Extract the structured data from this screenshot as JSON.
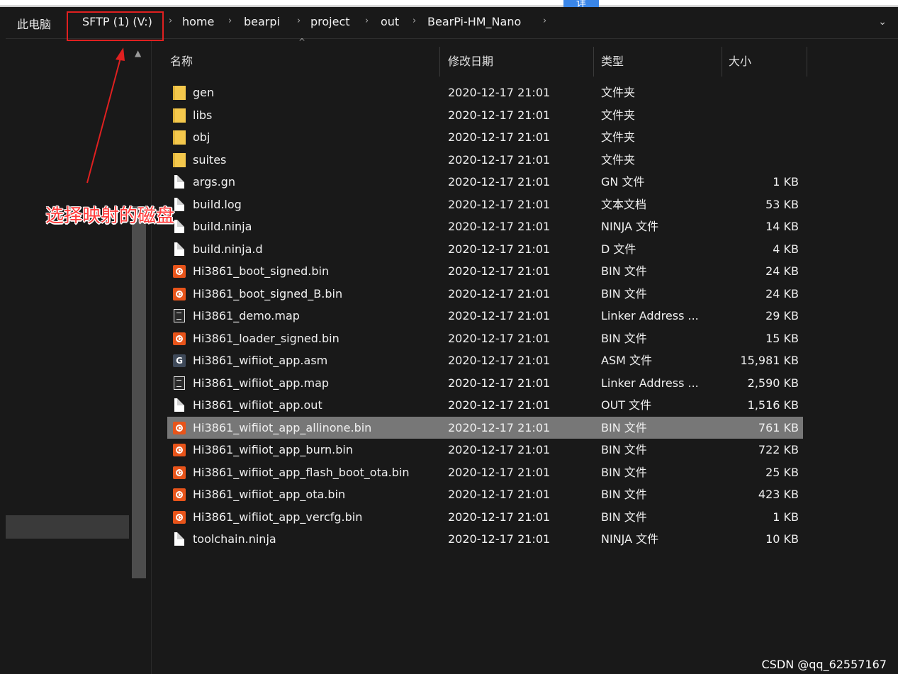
{
  "top_button": {
    "label": "详"
  },
  "address_bar": {
    "crumbs": [
      "此电脑",
      "SFTP (1) (V:)",
      "home",
      "bearpi",
      "project",
      "out",
      "BearPi-HM_Nano"
    ],
    "separator": "›",
    "dropdown": "⌄"
  },
  "annotation": {
    "text": "选择映射的磁盘",
    "color": "#e02020"
  },
  "columns": {
    "name": "名称",
    "date": "修改日期",
    "type": "类型",
    "size": "大小"
  },
  "files": [
    {
      "name": "gen",
      "date": "2020-12-17 21:01",
      "type": "文件夹",
      "size": "",
      "icon": "folder-icon"
    },
    {
      "name": "libs",
      "date": "2020-12-17 21:01",
      "type": "文件夹",
      "size": "",
      "icon": "folder-icon"
    },
    {
      "name": "obj",
      "date": "2020-12-17 21:01",
      "type": "文件夹",
      "size": "",
      "icon": "folder-icon"
    },
    {
      "name": "suites",
      "date": "2020-12-17 21:01",
      "type": "文件夹",
      "size": "",
      "icon": "folder-icon"
    },
    {
      "name": "args.gn",
      "date": "2020-12-17 21:01",
      "type": "GN 文件",
      "size": "1 KB",
      "icon": "file-icon"
    },
    {
      "name": "build.log",
      "date": "2020-12-17 21:01",
      "type": "文本文档",
      "size": "53 KB",
      "icon": "file-icon"
    },
    {
      "name": "build.ninja",
      "date": "2020-12-17 21:01",
      "type": "NINJA 文件",
      "size": "14 KB",
      "icon": "file-icon"
    },
    {
      "name": "build.ninja.d",
      "date": "2020-12-17 21:01",
      "type": "D 文件",
      "size": "4 KB",
      "icon": "file-icon"
    },
    {
      "name": "Hi3861_boot_signed.bin",
      "date": "2020-12-17 21:01",
      "type": "BIN 文件",
      "size": "24 KB",
      "icon": "bin-file-icon"
    },
    {
      "name": "Hi3861_boot_signed_B.bin",
      "date": "2020-12-17 21:01",
      "type": "BIN 文件",
      "size": "24 KB",
      "icon": "bin-file-icon"
    },
    {
      "name": "Hi3861_demo.map",
      "date": "2020-12-17 21:01",
      "type": "Linker Address ...",
      "size": "29 KB",
      "icon": "map-file-icon"
    },
    {
      "name": "Hi3861_loader_signed.bin",
      "date": "2020-12-17 21:01",
      "type": "BIN 文件",
      "size": "15 KB",
      "icon": "bin-file-icon"
    },
    {
      "name": "Hi3861_wifiiot_app.asm",
      "date": "2020-12-17 21:01",
      "type": "ASM 文件",
      "size": "15,981 KB",
      "icon": "asm-file-icon"
    },
    {
      "name": "Hi3861_wifiiot_app.map",
      "date": "2020-12-17 21:01",
      "type": "Linker Address ...",
      "size": "2,590 KB",
      "icon": "map-file-icon"
    },
    {
      "name": "Hi3861_wifiiot_app.out",
      "date": "2020-12-17 21:01",
      "type": "OUT 文件",
      "size": "1,516 KB",
      "icon": "file-icon"
    },
    {
      "name": "Hi3861_wifiiot_app_allinone.bin",
      "date": "2020-12-17 21:01",
      "type": "BIN 文件",
      "size": "761 KB",
      "icon": "bin-file-icon",
      "selected": true
    },
    {
      "name": "Hi3861_wifiiot_app_burn.bin",
      "date": "2020-12-17 21:01",
      "type": "BIN 文件",
      "size": "722 KB",
      "icon": "bin-file-icon"
    },
    {
      "name": "Hi3861_wifiiot_app_flash_boot_ota.bin",
      "date": "2020-12-17 21:01",
      "type": "BIN 文件",
      "size": "25 KB",
      "icon": "bin-file-icon"
    },
    {
      "name": "Hi3861_wifiiot_app_ota.bin",
      "date": "2020-12-17 21:01",
      "type": "BIN 文件",
      "size": "423 KB",
      "icon": "bin-file-icon"
    },
    {
      "name": "Hi3861_wifiiot_app_vercfg.bin",
      "date": "2020-12-17 21:01",
      "type": "BIN 文件",
      "size": "1 KB",
      "icon": "bin-file-icon"
    },
    {
      "name": "toolchain.ninja",
      "date": "2020-12-17 21:01",
      "type": "NINJA 文件",
      "size": "10 KB",
      "icon": "file-icon"
    }
  ],
  "watermark": "CSDN @qq_62557167"
}
